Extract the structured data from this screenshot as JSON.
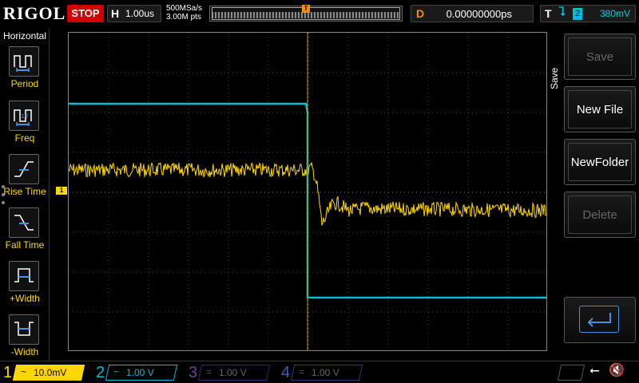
{
  "brand": {
    "logo": "RIGOL"
  },
  "run_state": {
    "label": "STOP",
    "color": "#d10000"
  },
  "horizontal": {
    "letter": "H",
    "timebase": "1.00us"
  },
  "acquisition": {
    "sample_rate": "500MSa/s",
    "memory_depth": "3.00M pts"
  },
  "delay": {
    "letter": "D",
    "value": "0.00000000ps"
  },
  "trigger": {
    "letter": "T",
    "edge_icon": "falling-edge-icon",
    "source": "2",
    "level": "380mV",
    "marker": "T"
  },
  "left_panel": {
    "title": "Horizontal",
    "items": [
      {
        "label": "Period",
        "icon": "period-icon"
      },
      {
        "label": "Freq",
        "icon": "frequency-icon"
      },
      {
        "label": "Rise Time",
        "icon": "rise-time-icon"
      },
      {
        "label": "Fall Time",
        "icon": "fall-time-icon"
      },
      {
        "label": "+Width",
        "icon": "positive-width-icon"
      },
      {
        "label": "-Width",
        "icon": "negative-width-icon"
      }
    ]
  },
  "right_panel": {
    "title": "Save",
    "buttons": [
      {
        "label": "Save",
        "enabled": false
      },
      {
        "label": "New File",
        "enabled": true
      },
      {
        "label": "NewFolder",
        "enabled": true
      },
      {
        "label": "Delete",
        "enabled": false
      },
      {
        "label": "",
        "icon": "enter-icon",
        "enabled": true
      }
    ]
  },
  "channels": [
    {
      "number": "1",
      "coupling": "~",
      "scale": "10.0mV",
      "color": "#ffd700",
      "active": true
    },
    {
      "number": "2",
      "coupling": "~",
      "scale": "1.00 V",
      "color": "#00bcd4",
      "active": true
    },
    {
      "number": "3",
      "coupling": "=",
      "scale": "1.00 V",
      "color": "#8a2be2",
      "active": false
    },
    {
      "number": "4",
      "coupling": "=",
      "scale": "1.00 V",
      "color": "#4169e1",
      "active": false
    }
  ],
  "markers": {
    "ch1": "1"
  },
  "status_icons": [
    "usb-icon",
    "speaker-muted-icon"
  ],
  "colors": {
    "ch1": "#ffd700",
    "ch2": "#00bcd4",
    "trigger": "#ff8c00",
    "grid": "#555555"
  }
}
